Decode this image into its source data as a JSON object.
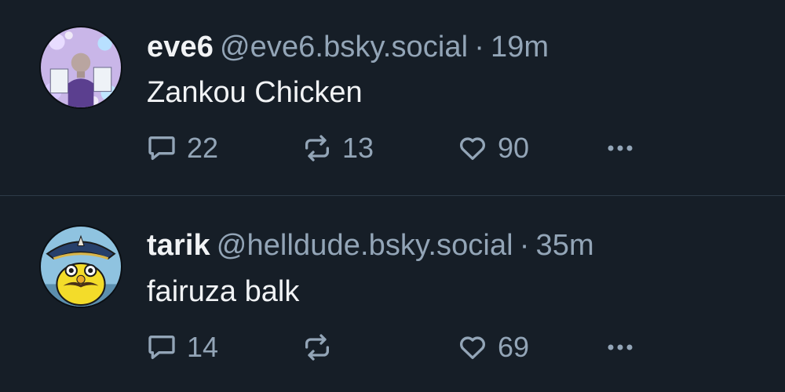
{
  "posts": [
    {
      "display_name": "eve6",
      "handle": "@eve6.bsky.social",
      "separator": "·",
      "time": "19m",
      "text": "Zankou Chicken",
      "counts": {
        "replies": "22",
        "reposts": "13",
        "likes": "90"
      }
    },
    {
      "display_name": "tarik",
      "handle": "@helldude.bsky.social",
      "separator": "·",
      "time": "35m",
      "text": "fairuza balk",
      "counts": {
        "replies": "14",
        "reposts": "",
        "likes": "69"
      }
    }
  ],
  "icons": {
    "reply": "speech-bubble-icon",
    "repost": "repost-arrows-icon",
    "like": "heart-icon",
    "more": "ellipsis-icon"
  },
  "colors": {
    "background": "#161e27",
    "primary_text": "#f1f3f5",
    "secondary_text": "#93a5b7",
    "divider": "#2e3a48"
  }
}
